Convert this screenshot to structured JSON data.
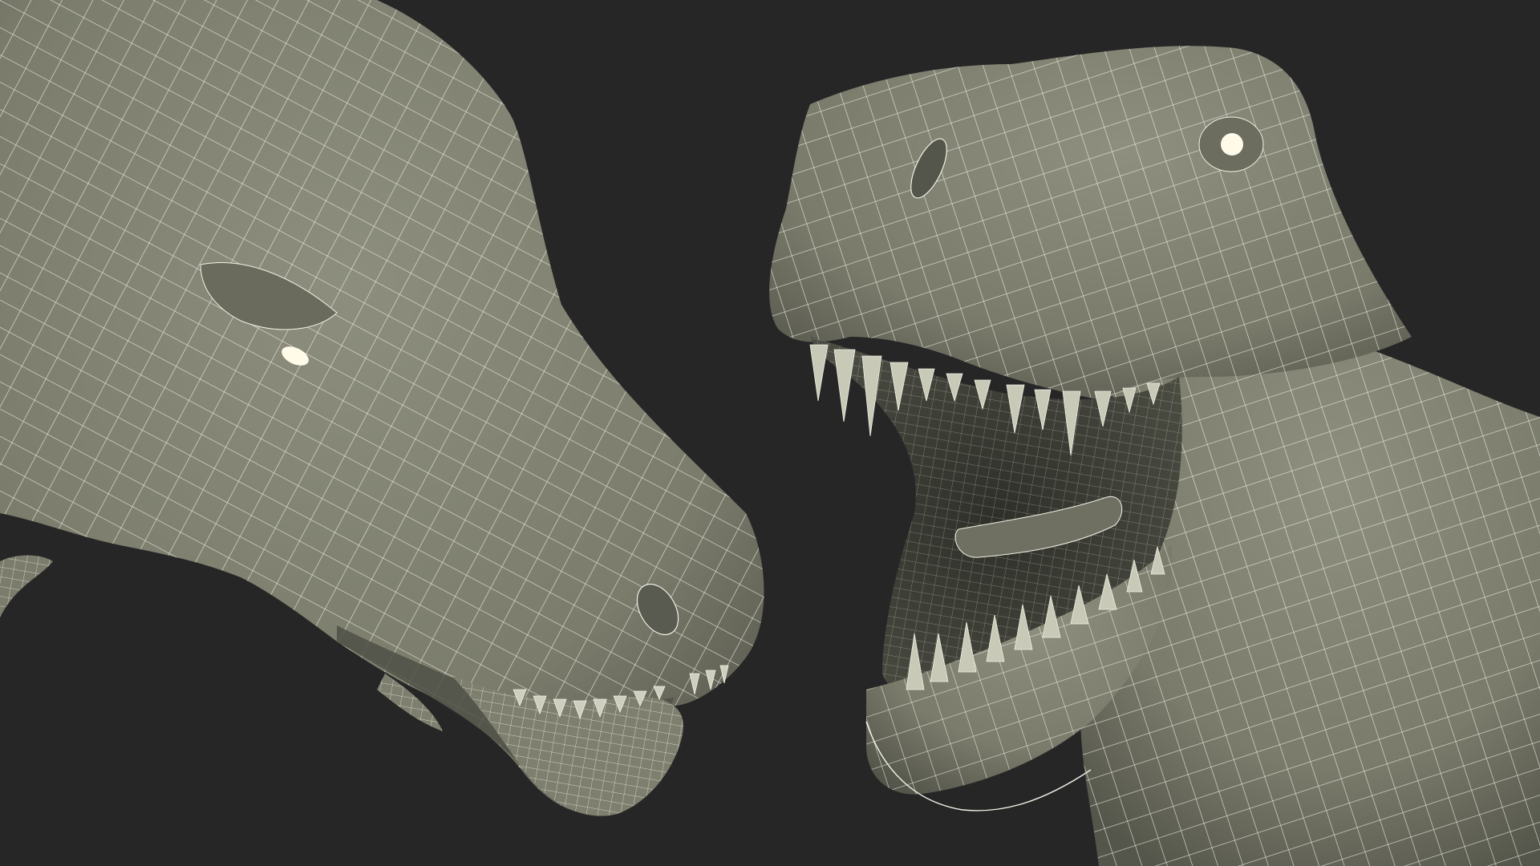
{
  "scene": {
    "background_color": "#262626",
    "surface_color": "#7b7c6c",
    "surface_shadow_color": "#4d4e44",
    "surface_highlight_color": "#9a9b8a",
    "wire_color": "#f2f2e6",
    "mouth_interior_color": "#3a3b33",
    "eye_color": "#fffbe8",
    "left_subject": "t-rex-head-wireframe-closed-jaw",
    "right_subject": "t-rex-head-wireframe-open-jaw"
  }
}
